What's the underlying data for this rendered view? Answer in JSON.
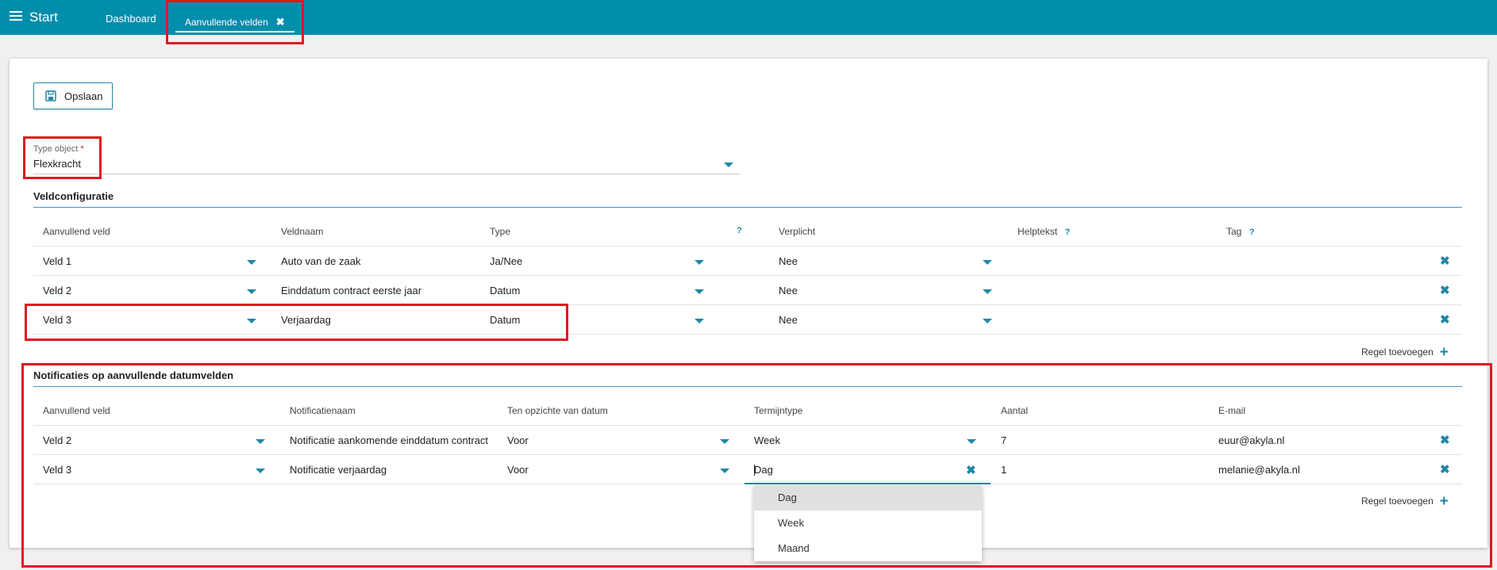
{
  "topbar": {
    "start_label": "Start",
    "tabs": [
      {
        "label": "Dashboard"
      },
      {
        "label": "Aanvullende velden",
        "close": "✖"
      }
    ]
  },
  "toolbar": {
    "save_label": "Opslaan"
  },
  "type_object": {
    "label": "Type object",
    "required_mark": "*",
    "value": "Flexkracht"
  },
  "veldconfiguratie": {
    "title": "Veldconfiguratie",
    "columns": [
      "Aanvullend veld",
      "Veldnaam",
      "Type",
      "Verplicht",
      "Helptekst",
      "Tag"
    ],
    "help_mark": "?",
    "rows": [
      {
        "veld": "Veld 1",
        "veldnaam": "Auto van de zaak",
        "type": "Ja/Nee",
        "verplicht": "Nee"
      },
      {
        "veld": "Veld 2",
        "veldnaam": "Einddatum contract eerste jaar",
        "type": "Datum",
        "verplicht": "Nee"
      },
      {
        "veld": "Veld 3",
        "veldnaam": "Verjaardag",
        "type": "Datum",
        "verplicht": "Nee"
      }
    ],
    "add_label": "Regel toevoegen",
    "add_icon": "+"
  },
  "notificaties": {
    "title": "Notificaties op aanvullende datumvelden",
    "columns": [
      "Aanvullend veld",
      "Notificatienaam",
      "Ten opzichte van datum",
      "Termijntype",
      "Aantal",
      "E-mail"
    ],
    "rows": [
      {
        "veld": "Veld 2",
        "naam": "Notificatie aankomende einddatum contract",
        "ten_opzichte": "Voor",
        "termijntype": "Week",
        "aantal": "7",
        "email": "euur@akyla.nl"
      },
      {
        "veld": "Veld 3",
        "naam": "Notificatie verjaardag",
        "ten_opzichte": "Voor",
        "termijntype": "Dag",
        "aantal": "1",
        "email": "melanie@akyla.nl"
      }
    ],
    "add_label": "Regel toevoegen",
    "add_icon": "+"
  },
  "dropdown": {
    "options": [
      "Dag",
      "Week",
      "Maand"
    ],
    "selected": "Dag"
  },
  "icons": {
    "delete": "✖",
    "caret": "chevron-down-icon",
    "save": "save-icon",
    "menu": "menu-icon"
  },
  "colors": {
    "topbar": "#008eab",
    "accent": "#1f86a7",
    "highlight": "#e0161f"
  }
}
